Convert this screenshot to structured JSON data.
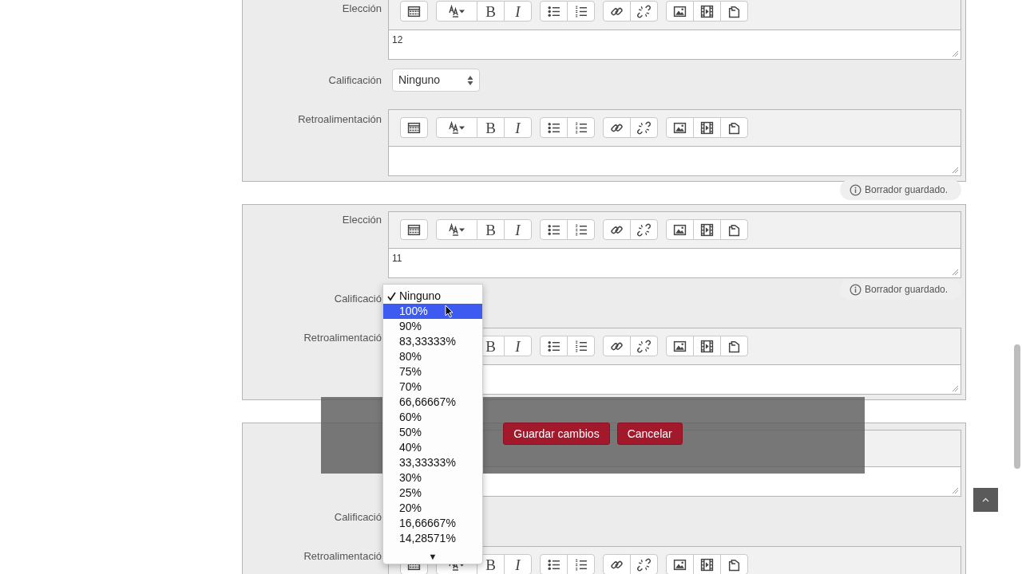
{
  "sections": [
    {
      "choice": {
        "label": "Elección",
        "text": "12",
        "bold": "B",
        "italic": "I"
      },
      "grade": {
        "label": "Calificación",
        "value": "Ninguno"
      },
      "feedback": {
        "label": "Retroalimentación",
        "bold": "B",
        "italic": "I"
      }
    },
    {
      "choice": {
        "label": "Elección",
        "text": "11",
        "bold": "B",
        "italic": "I"
      },
      "grade": {
        "label": "Calificació"
      },
      "feedback": {
        "label": "Retroalimentació",
        "bold": "B",
        "italic": "I"
      }
    },
    {
      "grade": {
        "label": "Calificació"
      },
      "feedback": {
        "label": "Retroalimentació",
        "bold": "B",
        "italic": "I"
      }
    }
  ],
  "draft_notices": [
    "Borrador guardado.",
    "Borrador guardado."
  ],
  "grade_dropdown": {
    "options": [
      {
        "label": "Ninguno",
        "selected": true,
        "highlighted": false
      },
      {
        "label": "100%",
        "selected": false,
        "highlighted": true
      },
      {
        "label": "90%",
        "selected": false,
        "highlighted": false
      },
      {
        "label": "83,33333%",
        "selected": false,
        "highlighted": false
      },
      {
        "label": "80%",
        "selected": false,
        "highlighted": false
      },
      {
        "label": "75%",
        "selected": false,
        "highlighted": false
      },
      {
        "label": "70%",
        "selected": false,
        "highlighted": false
      },
      {
        "label": "66,66667%",
        "selected": false,
        "highlighted": false
      },
      {
        "label": "60%",
        "selected": false,
        "highlighted": false
      },
      {
        "label": "50%",
        "selected": false,
        "highlighted": false
      },
      {
        "label": "40%",
        "selected": false,
        "highlighted": false
      },
      {
        "label": "33,33333%",
        "selected": false,
        "highlighted": false
      },
      {
        "label": "30%",
        "selected": false,
        "highlighted": false
      },
      {
        "label": "25%",
        "selected": false,
        "highlighted": false
      },
      {
        "label": "20%",
        "selected": false,
        "highlighted": false
      },
      {
        "label": "16,66667%",
        "selected": false,
        "highlighted": false
      },
      {
        "label": "14,28571%",
        "selected": false,
        "highlighted": false
      }
    ],
    "scroll_arrow": "▼"
  },
  "action_bar": {
    "buttons": [
      "Guardar cambios",
      "Cancelar"
    ]
  }
}
